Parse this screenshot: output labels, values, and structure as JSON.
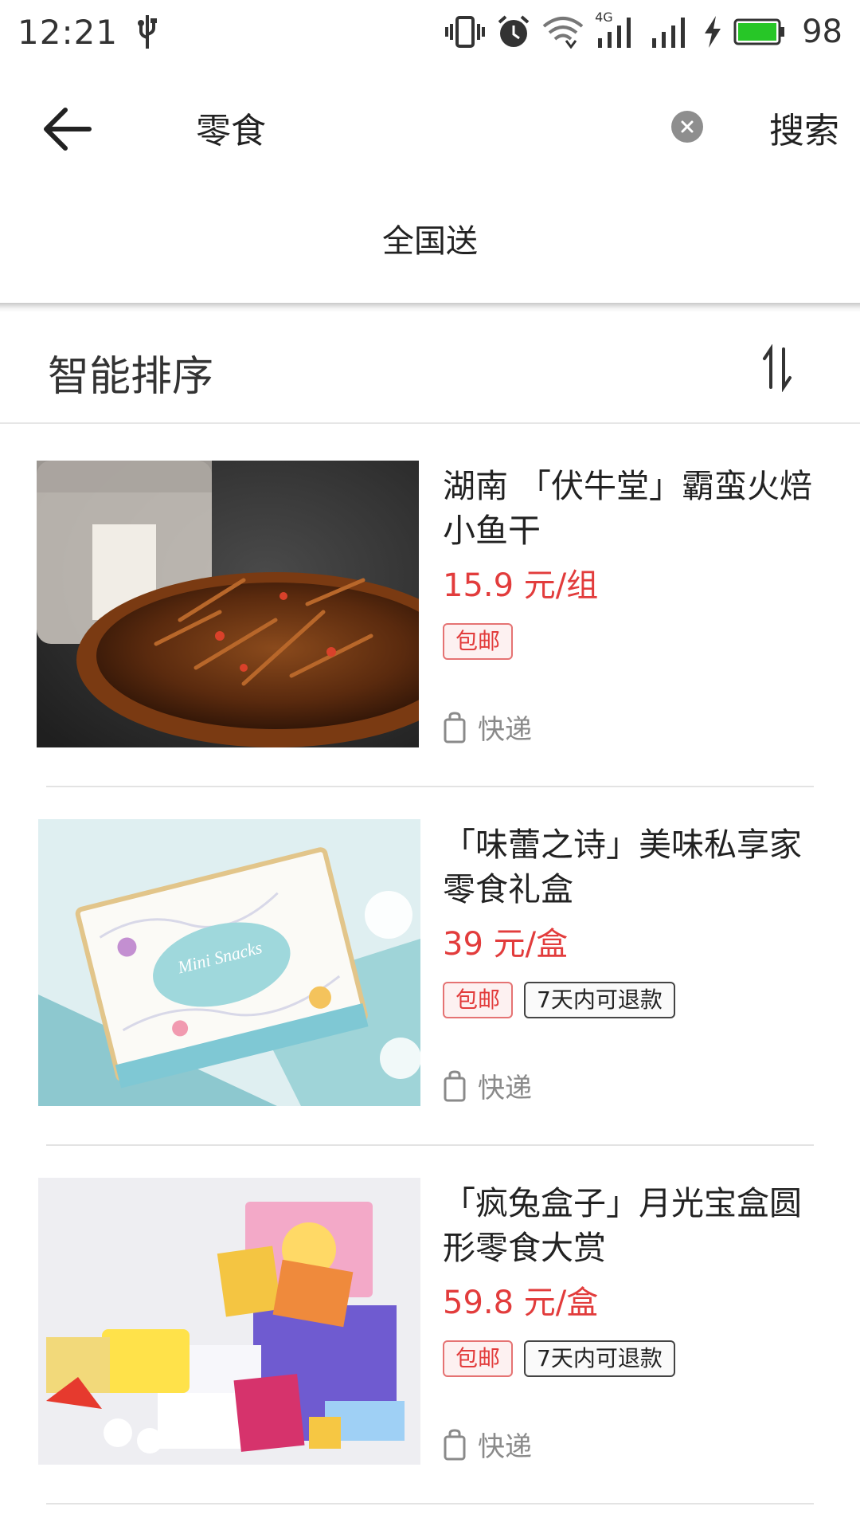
{
  "status_bar": {
    "time": "12:21",
    "network_label": "4G",
    "battery": "98",
    "battery_color": "#27c627"
  },
  "search": {
    "query": "零食",
    "search_button": "搜索"
  },
  "delivery_filter": "全国送",
  "sort": {
    "label": "智能排序"
  },
  "colors": {
    "price": "#e23c3c",
    "tag_border": "#e57373"
  },
  "products": [
    {
      "title": "湖南 「伏牛堂」霸蛮火焙小鱼干",
      "price": "15.9 元/组",
      "tags": [
        "包邮"
      ],
      "shipping": "快递",
      "image": "spicy-dried-fish-photo"
    },
    {
      "title": "「味蕾之诗」美味私享家零食礼盒",
      "price": "39 元/盒",
      "tags": [
        "包邮",
        "7天内可退款"
      ],
      "shipping": "快递",
      "image": "snack-gift-box-photo",
      "image_text": "Mini Snacks"
    },
    {
      "title": "「疯兔盒子」月光宝盒圆形零食大赏",
      "price": "59.8 元/盒",
      "tags": [
        "包邮",
        "7天内可退款"
      ],
      "shipping": "快递",
      "image": "snack-assortment-photo"
    }
  ]
}
